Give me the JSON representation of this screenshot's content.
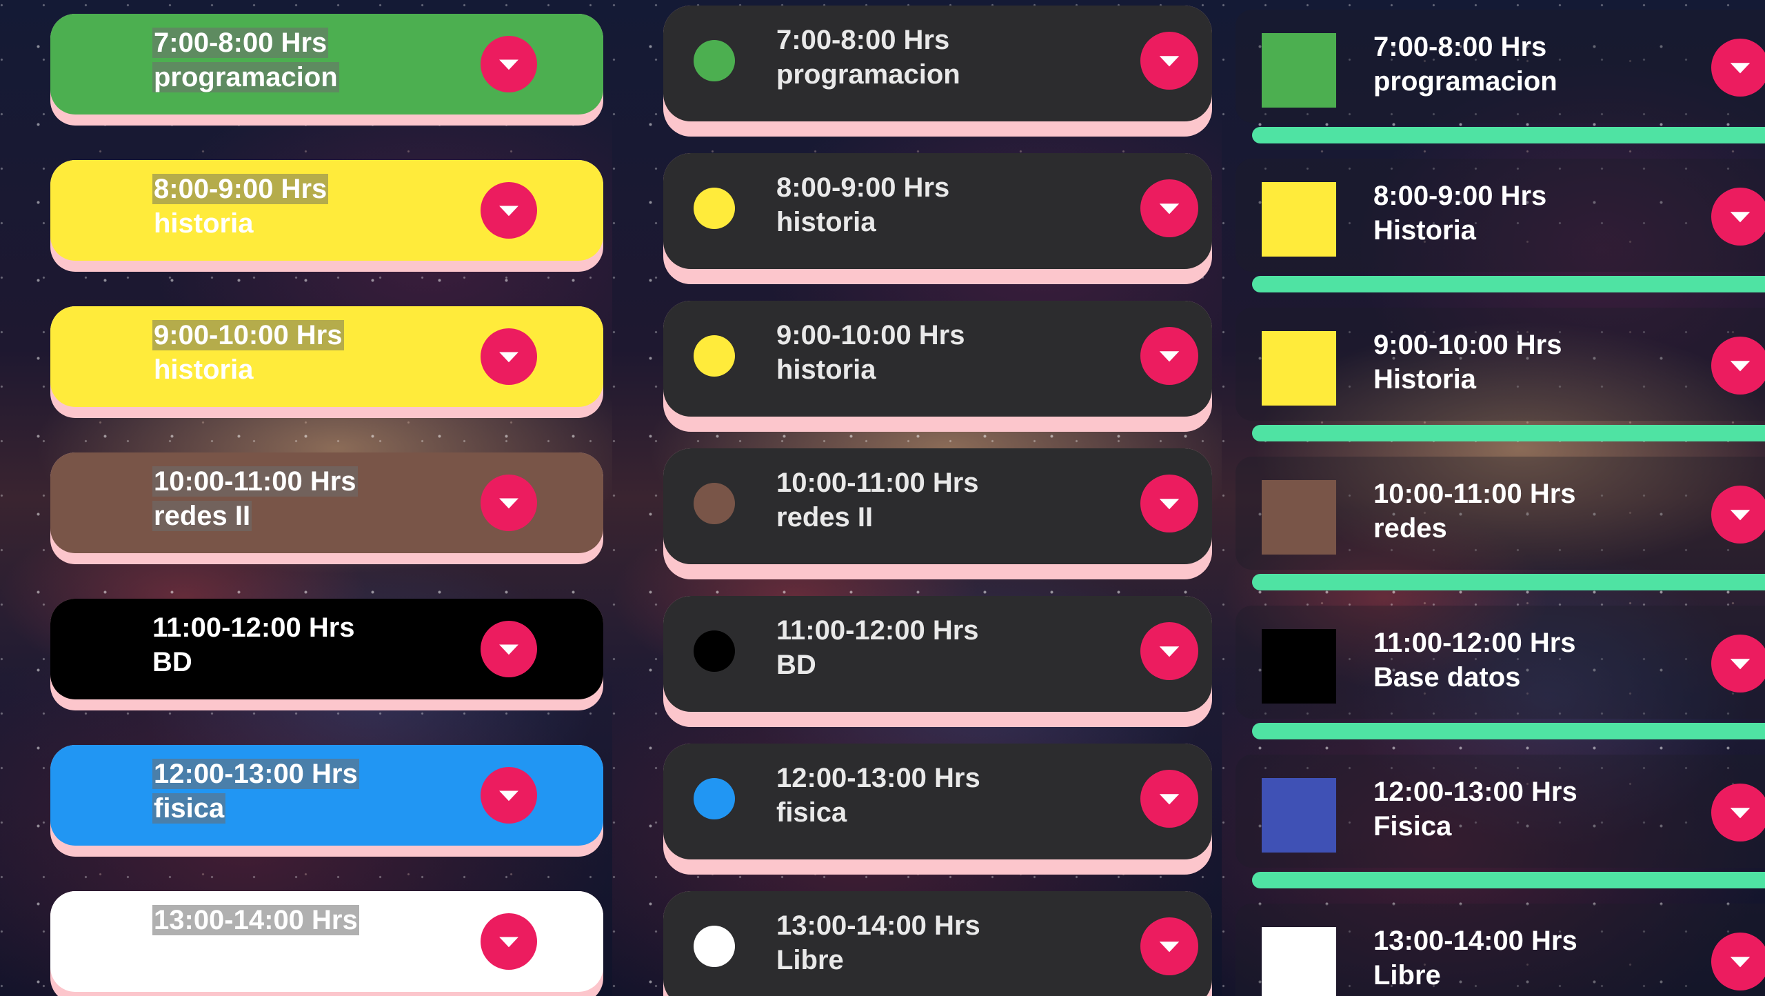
{
  "panels": [
    {
      "style": "colored-card",
      "separator_color": "#fcc6cc",
      "items": [
        {
          "title": "7:00-8:00 Hrs",
          "subject": "programacion",
          "color": "#4caf50",
          "highlight": true
        },
        {
          "title": "8:00-9:00 Hrs",
          "subject": "historia",
          "color": "#ffeb3b",
          "highlight": true
        },
        {
          "title": "9:00-10:00 Hrs",
          "subject": "historia",
          "color": "#ffeb3b",
          "highlight": true
        },
        {
          "title": "10:00-11:00 Hrs",
          "subject": "redes II",
          "color": "#795548",
          "highlight": true
        },
        {
          "title": "11:00-12:00 Hrs",
          "subject": "BD",
          "color": "#000000",
          "highlight": false
        },
        {
          "title": "12:00-13:00 Hrs",
          "subject": "fisica",
          "color": "#2196f3",
          "highlight": true
        },
        {
          "title": "13:00-14:00 Hrs",
          "subject": "",
          "color": "#ffffff",
          "highlight": true
        }
      ]
    },
    {
      "style": "dark-card-with-dot",
      "separator_color": "#fcc6cc",
      "items": [
        {
          "title": "7:00-8:00 Hrs",
          "subject": "programacion",
          "color": "#4caf50"
        },
        {
          "title": "8:00-9:00 Hrs",
          "subject": "historia",
          "color": "#ffeb3b"
        },
        {
          "title": "9:00-10:00 Hrs",
          "subject": "historia",
          "color": "#ffeb3b"
        },
        {
          "title": "10:00-11:00 Hrs",
          "subject": "redes II",
          "color": "#795548"
        },
        {
          "title": "11:00-12:00 Hrs",
          "subject": "BD",
          "color": "#000000"
        },
        {
          "title": "12:00-13:00 Hrs",
          "subject": "fisica",
          "color": "#2196f3"
        },
        {
          "title": "13:00-14:00 Hrs",
          "subject": "Libre",
          "color": "#ffffff"
        }
      ]
    },
    {
      "style": "square-swatch",
      "separator_color": "#4fe3a3",
      "items": [
        {
          "title": "7:00-8:00 Hrs",
          "subject": "programacion",
          "color": "#4caf50"
        },
        {
          "title": "8:00-9:00 Hrs",
          "subject": "Historia",
          "color": "#ffeb3b"
        },
        {
          "title": "9:00-10:00 Hrs",
          "subject": "Historia",
          "color": "#ffeb3b"
        },
        {
          "title": "10:00-11:00 Hrs",
          "subject": "redes",
          "color": "#795548"
        },
        {
          "title": "11:00-12:00 Hrs",
          "subject": "Base datos",
          "color": "#000000"
        },
        {
          "title": "12:00-13:00 Hrs",
          "subject": "Fisica",
          "color": "#3f51b5"
        },
        {
          "title": "13:00-14:00 Hrs",
          "subject": "Libre",
          "color": "#ffffff"
        }
      ]
    }
  ],
  "icons": {
    "expand_button": "chevron-down-icon",
    "button_color": "#ec1c5f"
  }
}
